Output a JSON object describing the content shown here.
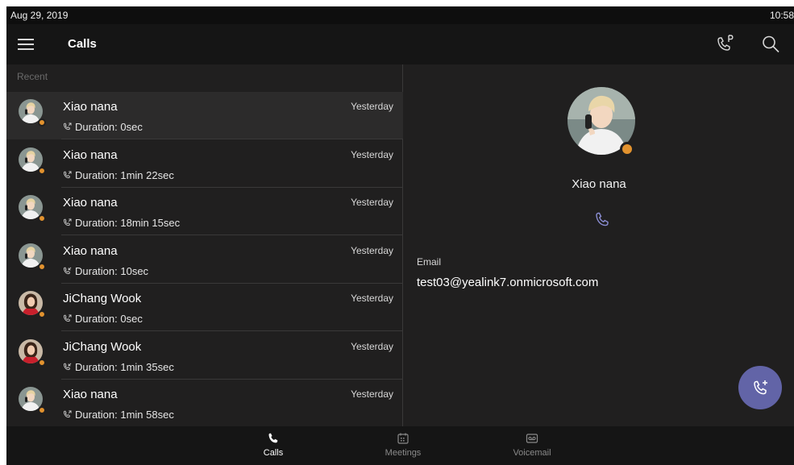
{
  "status_bar": {
    "date": "Aug 29, 2019",
    "time": "10:58"
  },
  "header": {
    "title": "Calls",
    "menu_icon": "hamburger-menu-icon",
    "park_icon": "call-park-icon",
    "search_icon": "search-icon"
  },
  "list": {
    "section_label": "Recent",
    "items": [
      {
        "name": "Xiao nana",
        "duration": "Duration: 0sec",
        "date": "Yesterday",
        "direction": "outgoing",
        "avatar": "male",
        "selected": true
      },
      {
        "name": "Xiao nana",
        "duration": "Duration: 1min 22sec",
        "date": "Yesterday",
        "direction": "outgoing",
        "avatar": "male",
        "selected": false
      },
      {
        "name": "Xiao nana",
        "duration": "Duration: 18min 15sec",
        "date": "Yesterday",
        "direction": "outgoing",
        "avatar": "male",
        "selected": false
      },
      {
        "name": "Xiao nana",
        "duration": "Duration: 10sec",
        "date": "Yesterday",
        "direction": "incoming",
        "avatar": "male",
        "selected": false
      },
      {
        "name": "JiChang Wook",
        "duration": "Duration: 0sec",
        "date": "Yesterday",
        "direction": "outgoing",
        "avatar": "female",
        "selected": false
      },
      {
        "name": "JiChang Wook",
        "duration": "Duration: 1min 35sec",
        "date": "Yesterday",
        "direction": "incoming",
        "avatar": "female",
        "selected": false
      },
      {
        "name": "Xiao nana",
        "duration": "Duration: 1min 58sec",
        "date": "Yesterday",
        "direction": "outgoing",
        "avatar": "male",
        "selected": false
      }
    ]
  },
  "detail": {
    "name": "Xiao nana",
    "email_label": "Email",
    "email": "test03@yealink7.onmicrosoft.com",
    "call_icon": "phone-icon"
  },
  "fab_icon": "add-call-icon",
  "bottom_nav": [
    {
      "label": "Calls",
      "icon": "phone-icon",
      "active": true
    },
    {
      "label": "Meetings",
      "icon": "calendar-icon",
      "active": false
    },
    {
      "label": "Voicemail",
      "icon": "voicemail-icon",
      "active": false
    }
  ],
  "colors": {
    "accent": "#6264a7",
    "presence_away": "#e2922e",
    "background": "#201f1f",
    "bar": "#151515"
  }
}
